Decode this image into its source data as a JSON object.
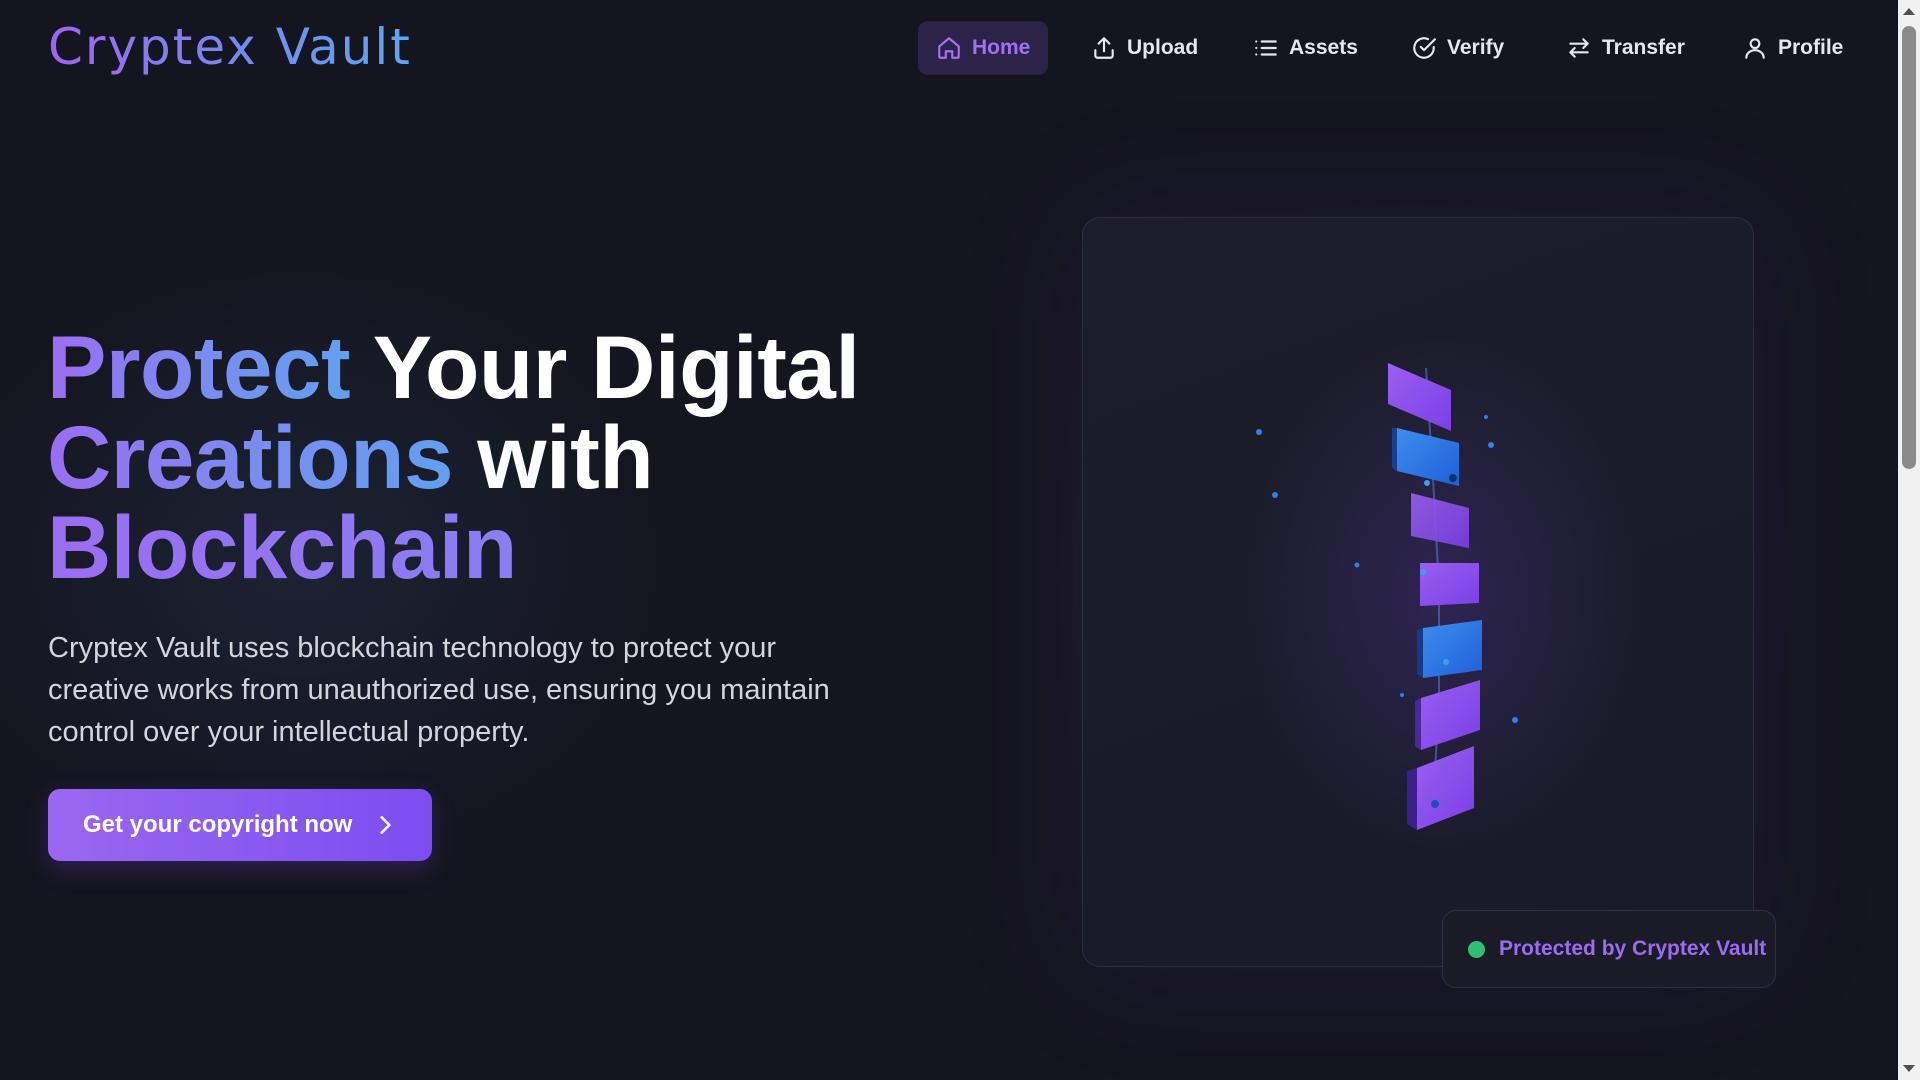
{
  "brand": {
    "logo": "Cryptex Vault"
  },
  "nav": {
    "items": [
      {
        "label": "Home",
        "icon": "home-icon",
        "active": true
      },
      {
        "label": "Upload",
        "icon": "upload-icon",
        "active": false
      },
      {
        "label": "Assets",
        "icon": "list-icon",
        "active": false
      },
      {
        "label": "Verify",
        "icon": "check-circle-icon",
        "active": false
      },
      {
        "label": "Transfer",
        "icon": "transfer-arrows-icon",
        "active": false
      },
      {
        "label": "Profile",
        "icon": "user-icon",
        "active": false
      }
    ]
  },
  "hero": {
    "headline": {
      "part1": "Protect",
      "part2": " Your Digital",
      "part3": "Creations",
      "part4": " with",
      "part5": "Blockchain"
    },
    "description": "Cryptex Vault uses blockchain technology to protect your creative works from unauthorized use, ensuring you maintain control over your intellectual property.",
    "cta_label": "Get your copyright now",
    "cta_icon": "chevron-right-icon"
  },
  "visual": {
    "badge_text": "Protected by Cryptex Vault",
    "badge_status_color": "#2fbf71"
  },
  "colors": {
    "accent_purple": "#9a68ef",
    "accent_blue": "#62a0ef",
    "background": "#15151f"
  }
}
